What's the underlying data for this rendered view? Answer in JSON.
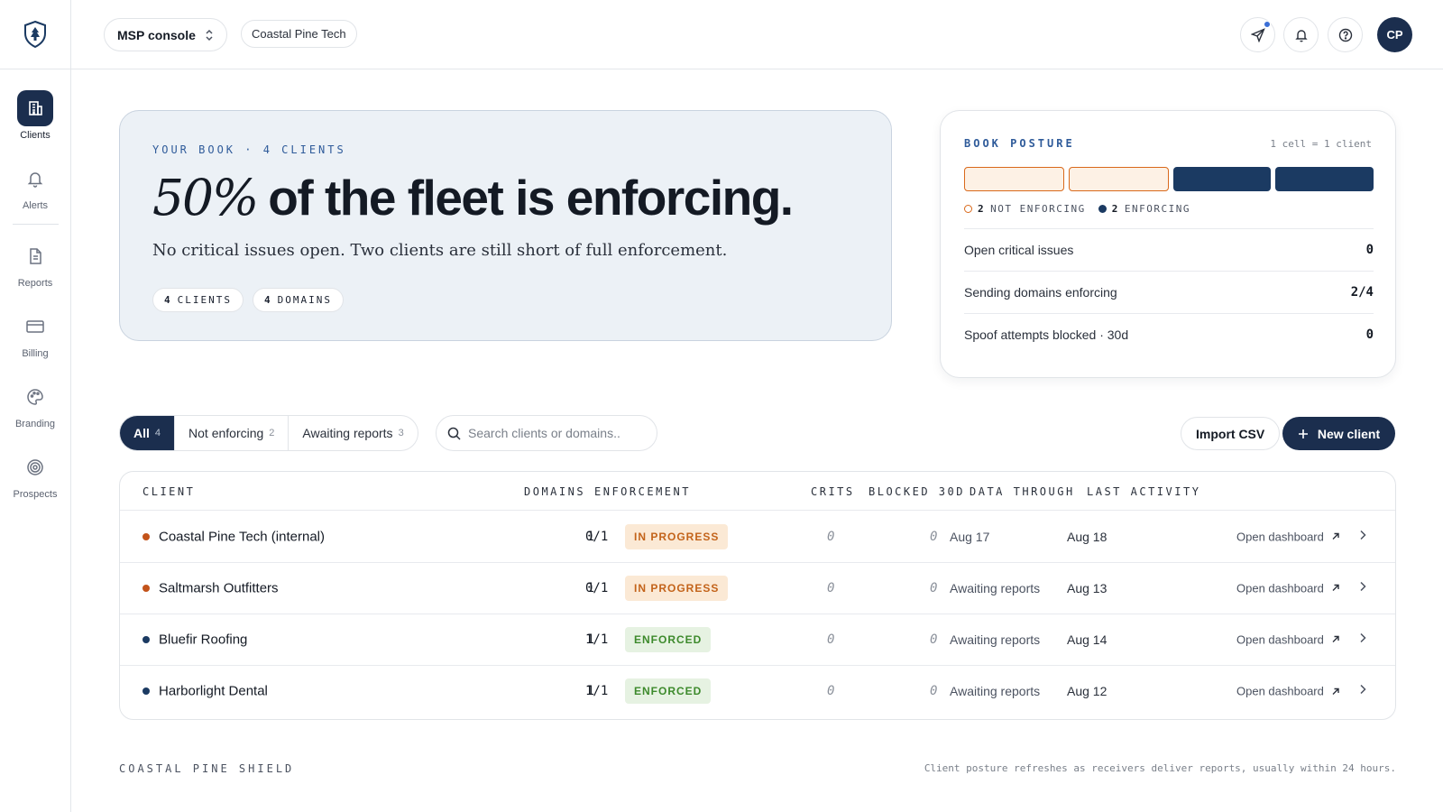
{
  "app": {
    "console_label": "MSP console",
    "org_name": "Coastal Pine Tech",
    "avatar_initials": "CP"
  },
  "sidebar": {
    "items": [
      {
        "label": "Clients",
        "icon": "building-icon",
        "active": true
      },
      {
        "label": "Alerts",
        "icon": "bell-icon",
        "active": false
      },
      {
        "label": "Reports",
        "icon": "document-icon",
        "active": false
      },
      {
        "label": "Billing",
        "icon": "credit-card-icon",
        "active": false
      },
      {
        "label": "Branding",
        "icon": "palette-icon",
        "active": false
      },
      {
        "label": "Prospects",
        "icon": "target-icon",
        "active": false
      }
    ]
  },
  "hero": {
    "eyebrow": "YOUR BOOK · 4 CLIENTS",
    "headline_pct": "50%",
    "headline_rest": "of the fleet is enforcing.",
    "subtitle": "No critical issues open. Two clients are still short of full enforcement.",
    "pills": [
      {
        "count": "4",
        "label": "CLIENTS"
      },
      {
        "count": "4",
        "label": "DOMAINS"
      }
    ]
  },
  "posture": {
    "title": "BOOK POSTURE",
    "note": "1 cell = 1 client",
    "cells": [
      "not",
      "not",
      "enf",
      "enf"
    ],
    "legend_not_count": "2",
    "legend_not_label": "NOT ENFORCING",
    "legend_enf_count": "2",
    "legend_enf_label": "ENFORCING",
    "stats": [
      {
        "label": "Open critical issues",
        "value": "0"
      },
      {
        "label": "Sending domains enforcing",
        "value": "2/4"
      },
      {
        "label": "Spoof attempts blocked · 30d",
        "value": "0"
      }
    ]
  },
  "filters": {
    "tabs": [
      {
        "label": "All",
        "count": "4",
        "active": true
      },
      {
        "label": "Not enforcing",
        "count": "2",
        "active": false
      },
      {
        "label": "Awaiting reports",
        "count": "3",
        "active": false
      }
    ],
    "search_placeholder": "Search clients or domains..",
    "import_label": "Import CSV",
    "new_client_label": "New client"
  },
  "table": {
    "headers": {
      "client": "CLIENT",
      "domains": "DOMAINS",
      "enforcement": "ENFORCEMENT",
      "crits": "CRITS",
      "blocked": "BLOCKED 30D",
      "data_through": "DATA THROUGH",
      "last_activity": "LAST ACTIVITY"
    },
    "open_label": "Open dashboard",
    "rows": [
      {
        "name": "Coastal Pine Tech (internal)",
        "status": "progress",
        "domains": "1",
        "ratio": "0/1",
        "badge": "IN PROGRESS",
        "crits": "0",
        "blocked": "0",
        "data_through": "Aug 17",
        "last_activity": "Aug 18"
      },
      {
        "name": "Saltmarsh Outfitters",
        "status": "progress",
        "domains": "1",
        "ratio": "0/1",
        "badge": "IN PROGRESS",
        "crits": "0",
        "blocked": "0",
        "data_through": "Awaiting reports",
        "last_activity": "Aug 13"
      },
      {
        "name": "Bluefir Roofing",
        "status": "enforced",
        "domains": "1",
        "ratio": "1/1",
        "badge": "ENFORCED",
        "crits": "0",
        "blocked": "0",
        "data_through": "Awaiting reports",
        "last_activity": "Aug 14"
      },
      {
        "name": "Harborlight Dental",
        "status": "enforced",
        "domains": "1",
        "ratio": "1/1",
        "badge": "ENFORCED",
        "crits": "0",
        "blocked": "0",
        "data_through": "Awaiting reports",
        "last_activity": "Aug 12"
      }
    ]
  },
  "footer": {
    "brand": "COASTAL PINE SHIELD",
    "note": "Client posture refreshes as receivers deliver reports, usually within 24 hours."
  },
  "colors": {
    "navy": "#1b2e4e",
    "orange": "#d9691b",
    "green": "#3d8a2c",
    "accent_blue": "#2f5b9a"
  }
}
